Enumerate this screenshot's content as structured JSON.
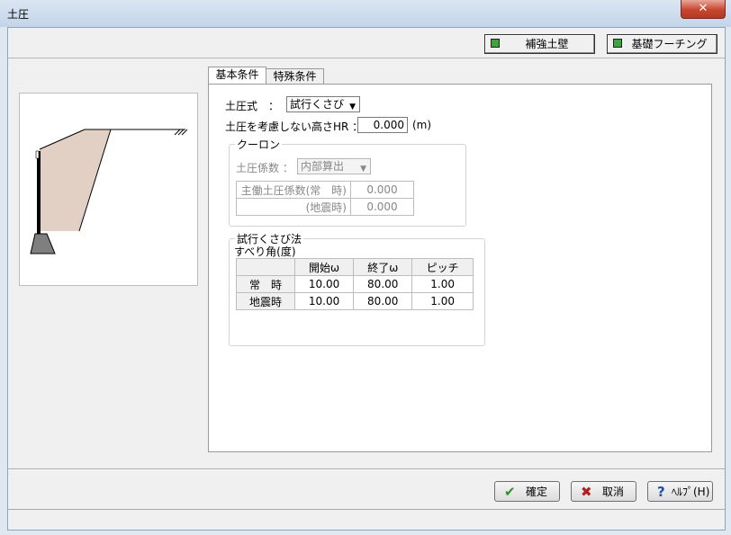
{
  "window": {
    "title": "土圧",
    "close_label": "✕"
  },
  "top_buttons": {
    "reinforced_wall": "補強土壁",
    "foundation_footing": "基礎フーチング"
  },
  "tabs": [
    {
      "label": "基本条件"
    },
    {
      "label": "特殊条件"
    }
  ],
  "basic": {
    "earth_pressure_formula_label": "土圧式　：",
    "earth_pressure_formula_value": "試行くさび",
    "hr_label": "土圧を考慮しない高さHR ：",
    "hr_value": "0.000",
    "hr_unit": "(m)"
  },
  "coulomb": {
    "group_title": "クーロン",
    "coef_label": "土圧係数 ：",
    "coef_value": "内部算出",
    "rows": [
      {
        "label": "主働土圧係数(常　時)",
        "value": "0.000"
      },
      {
        "label": "(地震時)",
        "value": "0.000"
      }
    ]
  },
  "trial_wedge": {
    "group_title": "試行くさび法",
    "subtitle": "すべり角(度)",
    "headers": [
      "開始ω",
      "終了ω",
      "ピッチ"
    ],
    "rows": [
      {
        "label": "常　時",
        "values": [
          "10.00",
          "80.00",
          "1.00"
        ]
      },
      {
        "label": "地震時",
        "values": [
          "10.00",
          "80.00",
          "1.00"
        ]
      }
    ]
  },
  "bottom_buttons": {
    "ok": "確定",
    "cancel": "取消",
    "help": "ﾍﾙﾌﾟ(H)"
  },
  "colors": {
    "soil_fill": "#e2d0c4",
    "footing": "#7f7f7f",
    "check_green": "#3da33d"
  }
}
